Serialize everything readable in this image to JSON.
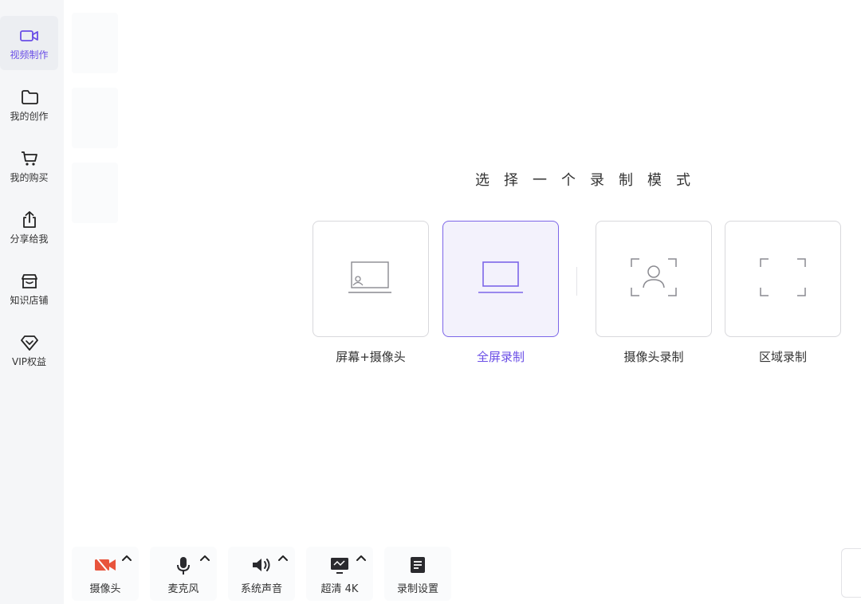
{
  "sidebar": {
    "items": [
      {
        "label": "视频制作",
        "icon": "video-camera-icon",
        "active": true
      },
      {
        "label": "我的创作",
        "icon": "folder-icon"
      },
      {
        "label": "我的购买",
        "icon": "cart-icon"
      },
      {
        "label": "分享给我",
        "icon": "share-icon"
      },
      {
        "label": "知识店铺",
        "icon": "store-icon"
      },
      {
        "label": "VIP权益",
        "icon": "diamond-icon"
      }
    ]
  },
  "main": {
    "title": "选择一个录制模式",
    "modes": [
      {
        "label": "屏幕+摄像头",
        "icon": "screen-camera-icon"
      },
      {
        "label": "全屏录制",
        "icon": "laptop-icon",
        "selected": true
      },
      {
        "label": "摄像头录制",
        "icon": "person-frame-icon"
      },
      {
        "label": "区域录制",
        "icon": "region-frame-icon"
      }
    ]
  },
  "toolbar": {
    "items": [
      {
        "label": "摄像头",
        "icon": "camera-off-icon",
        "has_menu": true
      },
      {
        "label": "麦克风",
        "icon": "microphone-icon",
        "has_menu": true
      },
      {
        "label": "系统声音",
        "icon": "speaker-icon",
        "has_menu": true
      },
      {
        "label": "超清 4K",
        "icon": "monitor-icon",
        "has_menu": true
      },
      {
        "label": "录制设置",
        "icon": "settings-doc-icon",
        "has_menu": false
      }
    ]
  },
  "colors": {
    "accent": "#6a4ee6",
    "selected_bg": "#f3f2fc",
    "camera_off": "#e8543c"
  }
}
